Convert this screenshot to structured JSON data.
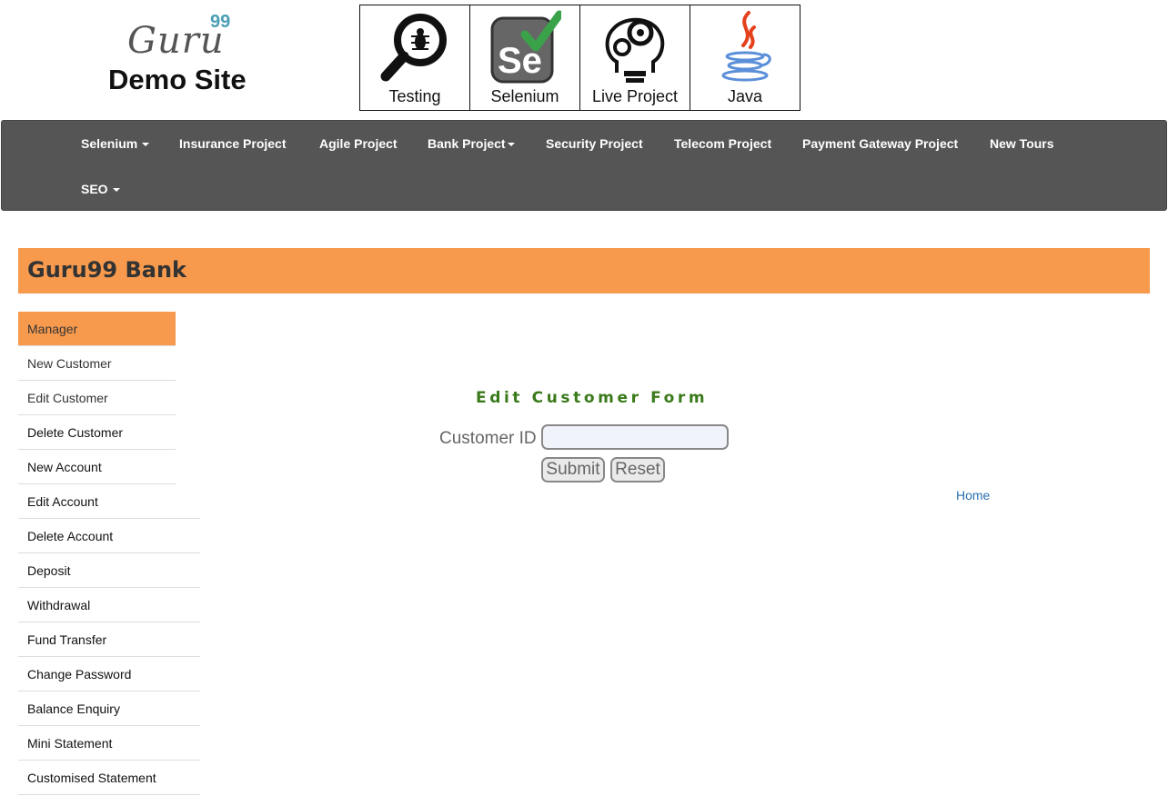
{
  "logo": {
    "guru": "Guru",
    "sup": "99",
    "subtitle": "Demo Site"
  },
  "tiles": [
    {
      "label": "Testing",
      "icon": "magnifier-bug-icon"
    },
    {
      "label": "Selenium",
      "icon": "selenium-logo-icon"
    },
    {
      "label": "Live Project",
      "icon": "gear-head-icon"
    },
    {
      "label": "Java",
      "icon": "java-logo-icon"
    }
  ],
  "nav": {
    "selenium": "Selenium",
    "insurance": "Insurance Project",
    "agile": "Agile Project",
    "bank": "Bank Project",
    "security": "Security Project",
    "telecom": "Telecom Project",
    "payment": "Payment Gateway Project",
    "newtours": "New Tours",
    "seo": "SEO"
  },
  "bank": {
    "title": "Guru99 Bank"
  },
  "sidebar": {
    "items": [
      "Manager",
      "New Customer",
      "Edit Customer",
      "Delete Customer",
      "New Account",
      "Edit Account",
      "Delete Account",
      "Deposit",
      "Withdrawal",
      "Fund Transfer",
      "Change Password",
      "Balance Enquiry",
      "Mini Statement",
      "Customised Statement"
    ]
  },
  "form": {
    "title": "Edit Customer Form",
    "customer_id_label": "Customer ID",
    "customer_id_value": "",
    "submit_label": "Submit",
    "reset_label": "Reset",
    "home_link": "Home"
  },
  "colors": {
    "accent": "#f79a4e",
    "navbar": "#555555",
    "form_title": "#3a7a1a",
    "link": "#2a6fb0"
  }
}
